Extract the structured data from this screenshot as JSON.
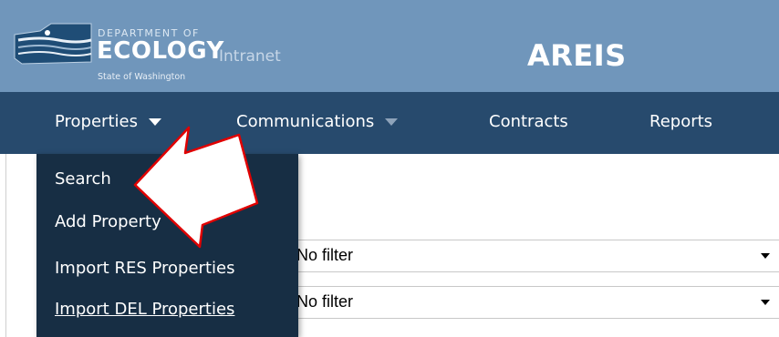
{
  "logo": {
    "department": "DEPARTMENT OF",
    "ecology": "ECOLOGY",
    "intranet": "Intranet",
    "state": "State of Washington"
  },
  "app_title": "AREIS",
  "nav": {
    "items": [
      {
        "label": "Properties",
        "icon": "chevron-down-icon"
      },
      {
        "label": "Communications",
        "icon": "chevron-down-icon"
      },
      {
        "label": "Contracts"
      },
      {
        "label": "Reports"
      }
    ]
  },
  "dropdown": {
    "items": [
      {
        "label": "Search"
      },
      {
        "label": "Add Property"
      },
      {
        "label": "Import RES Properties"
      },
      {
        "label": "Import DEL Properties"
      }
    ]
  },
  "filters": [
    {
      "value": "No filter"
    },
    {
      "value": "No filter"
    }
  ],
  "colors": {
    "header_bg": "#7096bb",
    "nav_bg": "#274a6d",
    "dropdown_bg": "#172e44",
    "arrow_outline": "#e00000"
  }
}
